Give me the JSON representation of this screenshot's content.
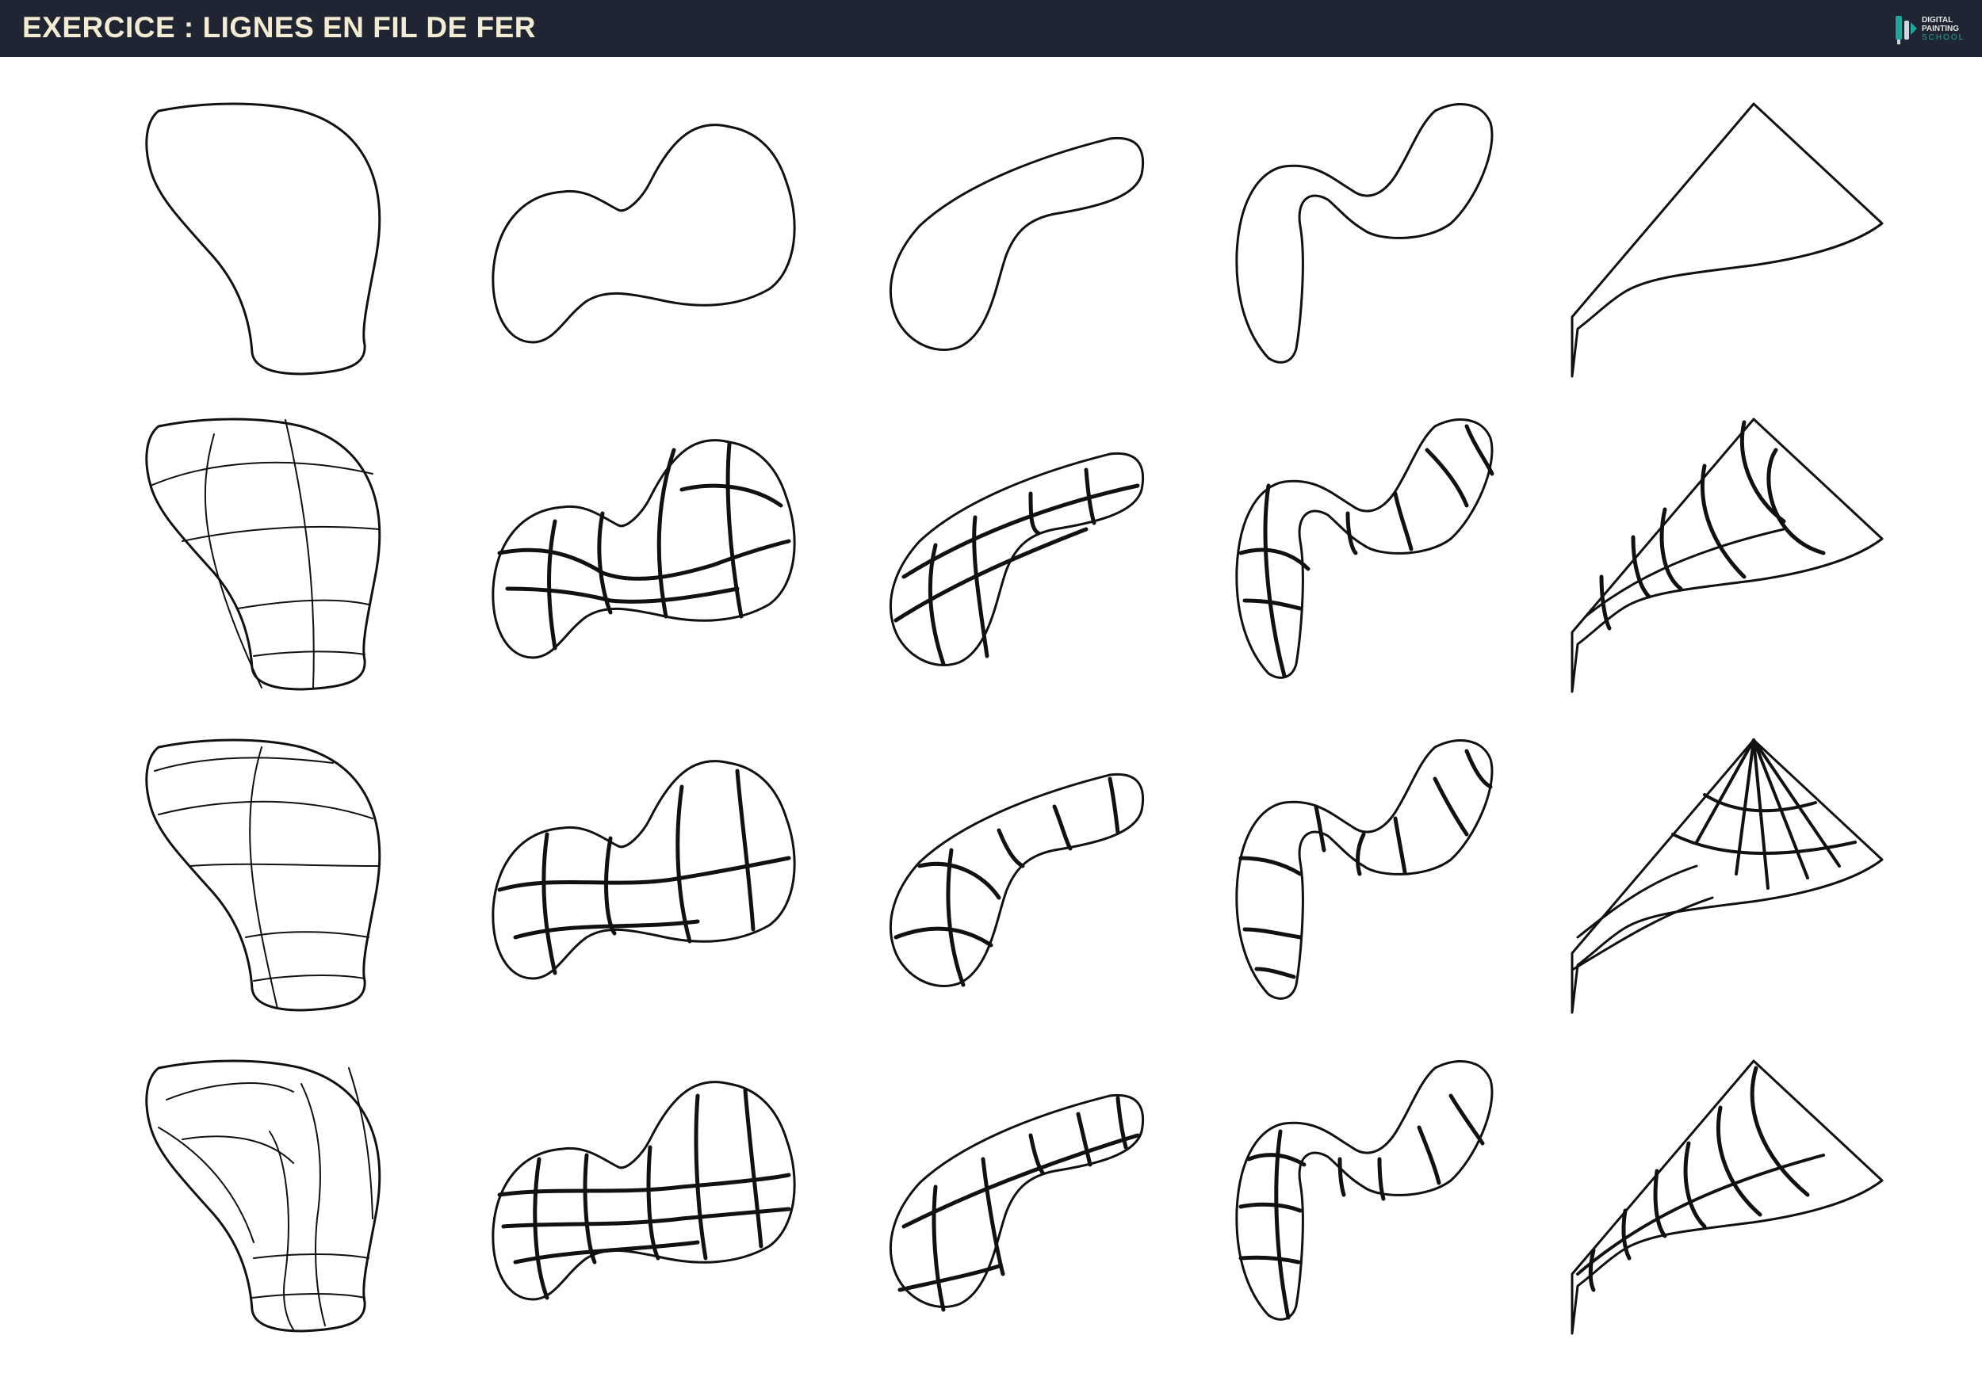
{
  "header": {
    "title": "EXERCICE : LIGNES EN FIL DE FER",
    "logo": {
      "line1": "DIGITAL",
      "line2": "PAINTING",
      "line3": "SCHOOL",
      "icon": "brush-logo-icon",
      "accent_color": "#1fa89b"
    },
    "background_color": "#1f2532",
    "title_color": "#f4ecd2"
  },
  "grid": {
    "rows": 4,
    "columns": 5,
    "row_descriptions": [
      "outline",
      "wireframe-example-1",
      "wireframe-example-2",
      "wireframe-example-3"
    ],
    "columns_shapes": [
      "blob-bean",
      "double-hump",
      "elongated-capsule",
      "s-hook",
      "triangular-fan"
    ]
  }
}
